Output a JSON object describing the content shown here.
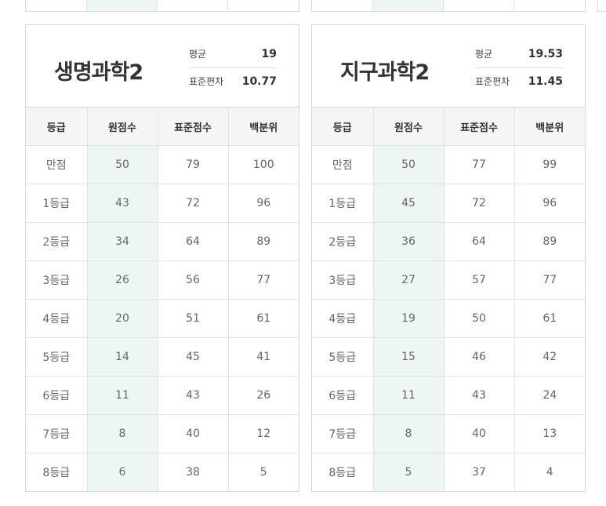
{
  "headers": [
    "등급",
    "원점수",
    "표준점수",
    "백분위"
  ],
  "left": {
    "subject": "생명과학2",
    "avg_label": "평균",
    "avg_value": "19",
    "sd_label": "표준편차",
    "sd_value": "10.77",
    "rows": [
      [
        "만점",
        "50",
        "79",
        "100"
      ],
      [
        "1등급",
        "43",
        "72",
        "96"
      ],
      [
        "2등급",
        "34",
        "64",
        "89"
      ],
      [
        "3등급",
        "26",
        "56",
        "77"
      ],
      [
        "4등급",
        "20",
        "51",
        "61"
      ],
      [
        "5등급",
        "14",
        "45",
        "41"
      ],
      [
        "6등급",
        "11",
        "43",
        "26"
      ],
      [
        "7등급",
        "8",
        "40",
        "12"
      ],
      [
        "8등급",
        "6",
        "38",
        "5"
      ]
    ]
  },
  "right": {
    "subject": "지구과학2",
    "avg_label": "평균",
    "avg_value": "19.53",
    "sd_label": "표준편차",
    "sd_value": "11.45",
    "rows": [
      [
        "만점",
        "50",
        "77",
        "99"
      ],
      [
        "1등급",
        "45",
        "72",
        "96"
      ],
      [
        "2등급",
        "36",
        "64",
        "89"
      ],
      [
        "3등급",
        "27",
        "57",
        "77"
      ],
      [
        "4등급",
        "19",
        "50",
        "61"
      ],
      [
        "5등급",
        "15",
        "46",
        "42"
      ],
      [
        "6등급",
        "11",
        "43",
        "24"
      ],
      [
        "7등급",
        "8",
        "40",
        "13"
      ],
      [
        "8등급",
        "5",
        "37",
        "4"
      ]
    ]
  }
}
